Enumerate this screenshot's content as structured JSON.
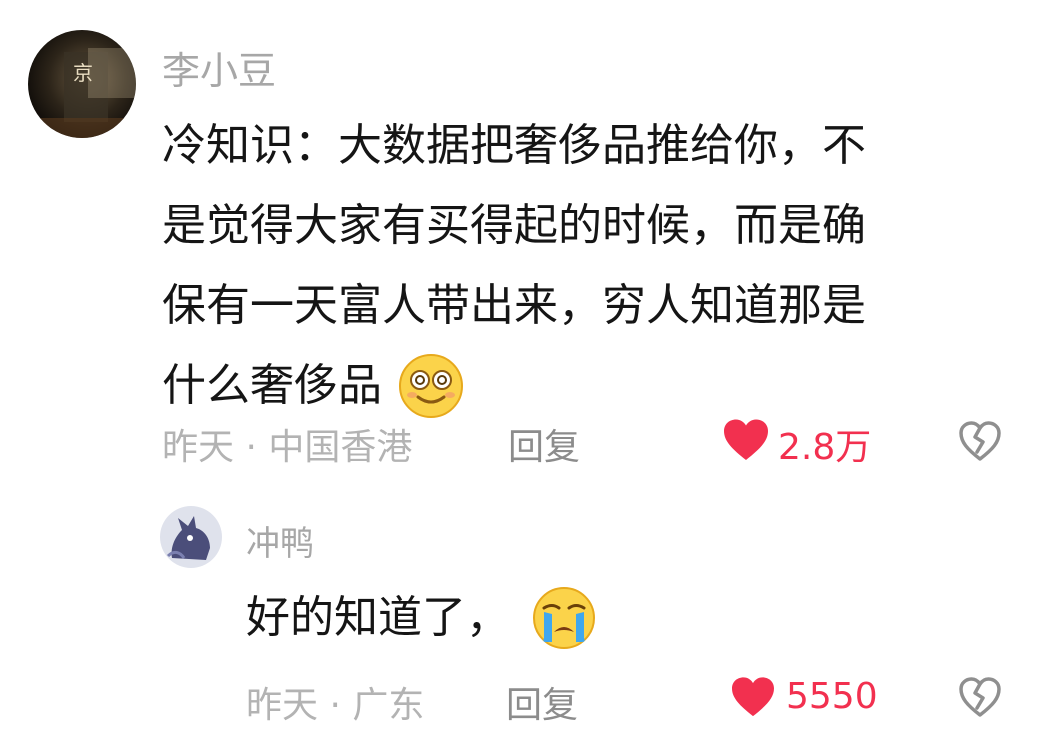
{
  "comments": [
    {
      "username": "李小豆",
      "text_lines": [
        "冷知识：大数据把奢侈品推给你，不",
        "是觉得大家有买得起的时候，而是确",
        "保有一天富人带出来，穷人知道那是",
        "什么奢侈品"
      ],
      "emoji": "dizzy-face-emoji",
      "time_location": "昨天 · 中国香港",
      "reply_label": "回复",
      "like_count": "2.8万"
    },
    {
      "username": "冲鸭",
      "text": "好的知道了，",
      "emoji": "crying-face-emoji",
      "time_location": "昨天 · 广东",
      "reply_label": "回复",
      "like_count": "5550"
    }
  ],
  "colors": {
    "like_red": "#f2304f",
    "name_gray": "#a7a7a7",
    "text_black": "#151515"
  },
  "icons": [
    "heart-icon",
    "dislike-broken-heart-icon"
  ]
}
